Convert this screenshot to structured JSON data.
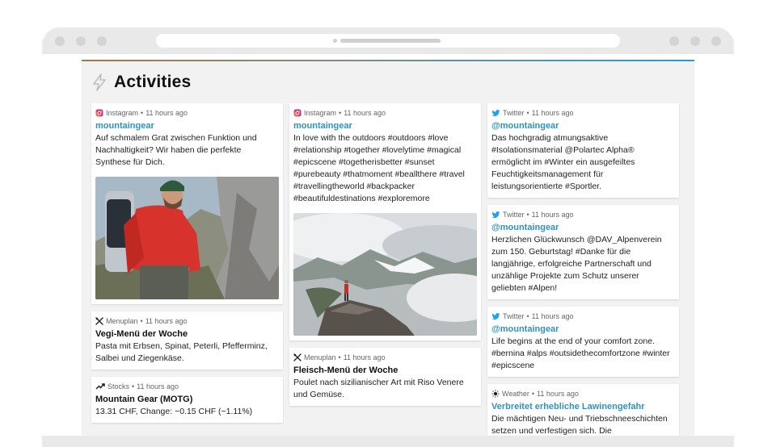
{
  "page": {
    "title": "Activities"
  },
  "columns": [
    [
      {
        "source": "Instagram",
        "time": "11 hours ago",
        "title": "mountaingear",
        "text": "Auf schmalem Grat zwischen Funktion und Nachhaltigkeit? Wir haben die perfekte Synthese für Dich.",
        "icon": "instagram-icon"
      },
      {
        "source": "Menuplan",
        "time": "11 hours ago",
        "title": "Vegi-Menü der Woche",
        "text": "Pasta mit Erbsen, Spinat, Peterli, Pfefferminz, Salbei und Ziegenkäse.",
        "icon": "cutlery-icon"
      },
      {
        "source": "Stocks",
        "time": "11 hours ago",
        "title": "Mountain Gear (MOTG)",
        "text": "13.31 CHF, Change: −0.15 CHF (−1.11%)",
        "icon": "trend-icon"
      }
    ],
    [
      {
        "source": "Instagram",
        "time": "11 hours ago",
        "title": "mountaingear",
        "text": "In love with the outdoors #outdoors #love #relationship #together #lovelytime #magical #epicscene #togetherisbetter #sunset #purebeauty #thatmoment #beallthere #travel #travellingtheworld #backpacker #beautifuldestinations #exploremore",
        "icon": "instagram-icon"
      },
      {
        "source": "Menuplan",
        "time": "11 hours ago",
        "title": "Fleisch-Menü der Woche",
        "text": "Poulet nach sizilianischer Art mit Riso Venere und Gemüse.",
        "icon": "cutlery-icon"
      }
    ],
    [
      {
        "source": "Twitter",
        "time": "11 hours ago",
        "title": "@mountaingear",
        "text": "Das hochgradig atmungsaktive #Isolationsmaterial @Polartec Alpha® ermöglicht im #Winter ein ausgefeiltes Feuchtigkeitsmanagement für leistungsorientierte #Sportler.",
        "icon": "twitter-icon"
      },
      {
        "source": "Twitter",
        "time": "11 hours ago",
        "title": "@mountaingear",
        "text": "Herzlichen Glückwunsch @DAV_Alpenverein zum 150. Geburtstag! #Danke für die langjährige, erfolgreiche Partnerschaft und unzählige Projekte zum Schutz unserer geliebten #Alpen!",
        "icon": "twitter-icon"
      },
      {
        "source": "Twitter",
        "time": "11 hours ago",
        "title": "@mountaingear",
        "text": "Life begins at the end of your comfort zone. #bernina #alps #outsidethecomfortzone #winter #epicscene",
        "icon": "twitter-icon"
      },
      {
        "source": "Weather",
        "time": "11 hours ago",
        "title": "Verbreitet erhebliche Lawinengefahr",
        "text": "Die mächtigen Neu- und Triebschneeschichten setzen und verfestigen sich. Die",
        "icon": "sun-icon"
      }
    ]
  ],
  "separator": " • ",
  "colors": {
    "accent": "#2b93c5",
    "instagram": "#c13584",
    "twitter": "#1da1f2"
  }
}
